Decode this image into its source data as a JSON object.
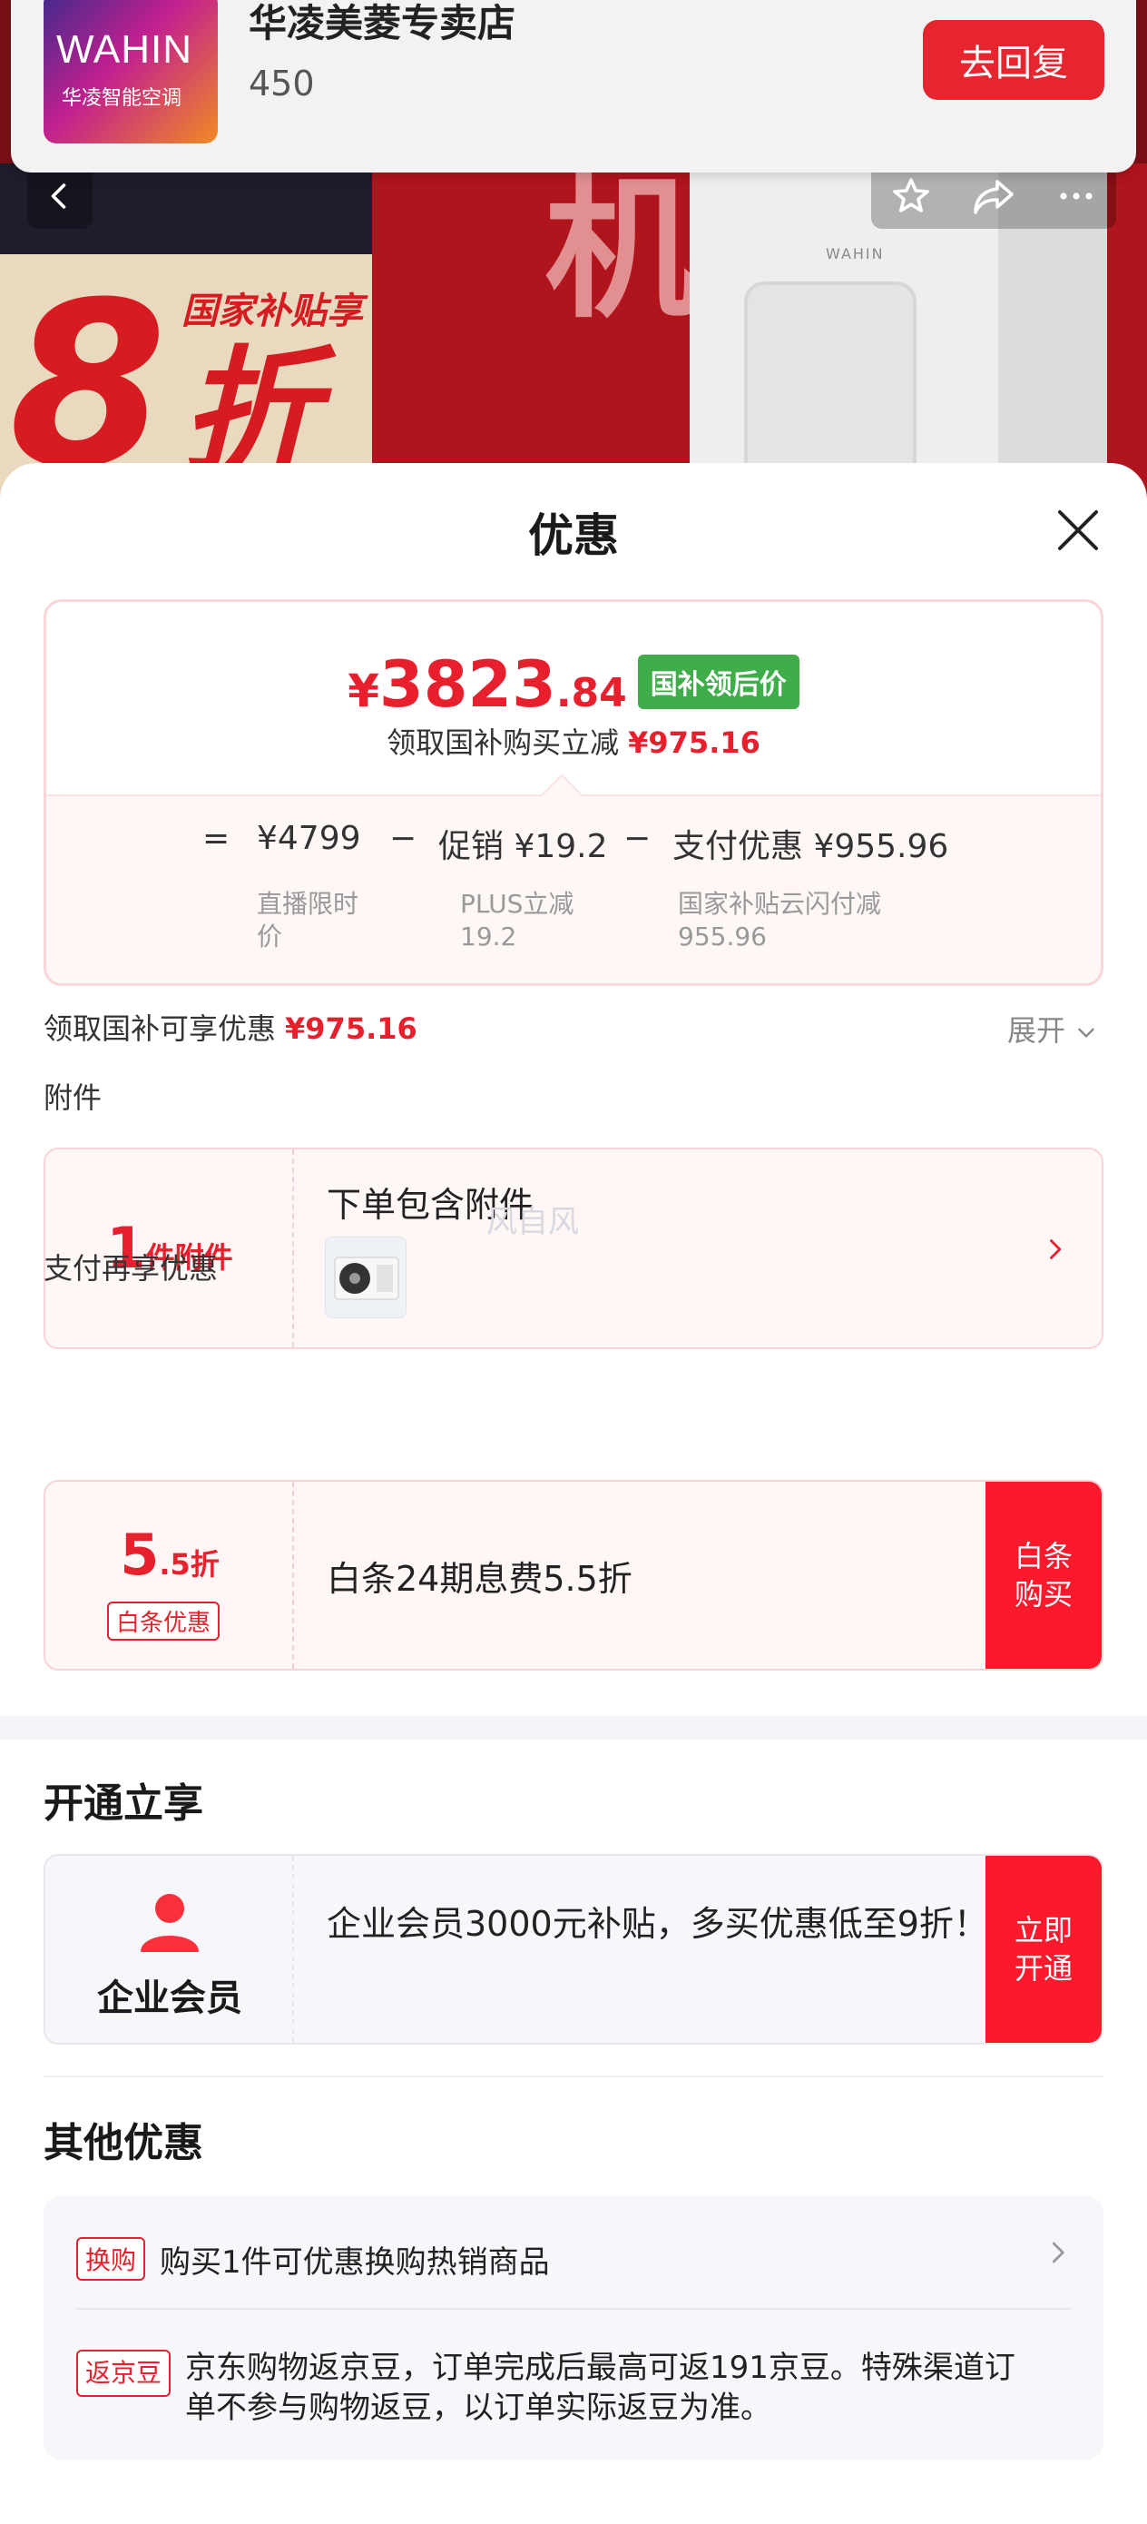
{
  "shop": {
    "logo_text": "WAHIN",
    "logo_sub": "华凌智能空调",
    "name": "华凌美菱专卖店",
    "count": "450",
    "reply_label": "去回复"
  },
  "banner": {
    "big_number": "8",
    "zhe": "折",
    "tag": "国家补贴享",
    "ji": "机",
    "brand": "WAHIN"
  },
  "sheet": {
    "title": "优惠"
  },
  "price_card": {
    "currency": "¥",
    "price_int": "3823",
    "price_dec": ".84",
    "tag": "国补领后价",
    "sub_text": "领取国补购买立减",
    "sub_amount": "¥975.16",
    "formula": {
      "eq": "=",
      "base": "¥4799",
      "minus1": "−",
      "promo": "促销 ¥19.2",
      "minus2": "−",
      "pay": "支付优惠 ¥955.96",
      "base_desc": "直播限时价",
      "promo_desc_1": "PLUS立减",
      "promo_desc_2": "19.2",
      "pay_desc_1": "国家补贴云闪付减",
      "pay_desc_2": "955.96"
    }
  },
  "subsidy_row": {
    "label": "领取国补可享优惠",
    "amount": "¥975.16",
    "expand": "展开"
  },
  "accessory": {
    "section_label": "附件",
    "count": "1",
    "unit": "件附件",
    "title": "下单包含附件",
    "watermark": "风自风"
  },
  "pay_again": {
    "section_label": "支付再享优惠",
    "discount_big": "5",
    "discount_small": ".5折",
    "badge": "白条优惠",
    "desc": "白条24期息费5.5折",
    "btn_1": "白条",
    "btn_2": "购买"
  },
  "open_enjoy": {
    "title": "开通立享",
    "member_label": "企业会员",
    "desc": "企业会员3000元补贴，多买优惠低至9折！",
    "btn_1": "立即",
    "btn_2": "开通"
  },
  "other": {
    "title": "其他优惠",
    "items": [
      {
        "badge": "换购",
        "text": "购买1件可优惠换购热销商品"
      },
      {
        "badge": "返京豆",
        "text": "京东购物返京豆，订单完成后最高可返191京豆。特殊渠道订单不参与购物返豆，以订单实际返豆为准。"
      }
    ]
  },
  "colors": {
    "accent_red": "#e8202d",
    "button_red": "#fa1a2c",
    "tag_green": "#3fae4a"
  }
}
